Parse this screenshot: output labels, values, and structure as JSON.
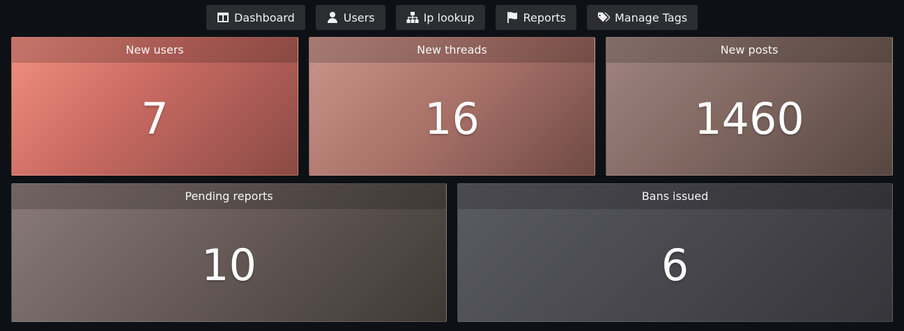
{
  "nav": {
    "items": [
      {
        "label": "Dashboard",
        "icon": "dashboard-icon"
      },
      {
        "label": "Users",
        "icon": "user-icon"
      },
      {
        "label": "Ip lookup",
        "icon": "network-icon"
      },
      {
        "label": "Reports",
        "icon": "flag-icon"
      },
      {
        "label": "Manage Tags",
        "icon": "tags-icon"
      }
    ]
  },
  "stats": {
    "new_users": {
      "label": "New users",
      "value": "7"
    },
    "new_threads": {
      "label": "New threads",
      "value": "16"
    },
    "new_posts": {
      "label": "New posts",
      "value": "1460"
    },
    "pending_reports": {
      "label": "Pending reports",
      "value": "10"
    },
    "bans_issued": {
      "label": "Bans issued",
      "value": "6"
    }
  }
}
